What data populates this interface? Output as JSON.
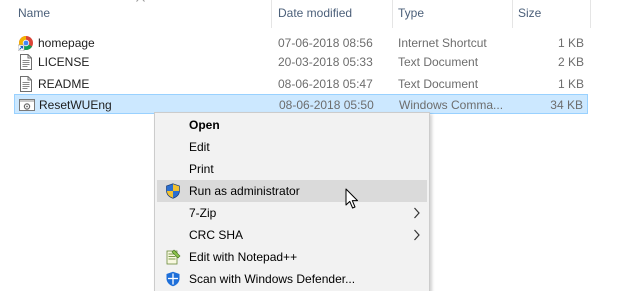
{
  "columns": {
    "name": "Name",
    "date": "Date modified",
    "type": "Type",
    "size": "Size"
  },
  "files": [
    {
      "name": "homepage",
      "date": "07-06-2018 08:56",
      "type": "Internet Shortcut",
      "size": "1 KB",
      "icon": "chrome-shortcut-icon",
      "selected": false
    },
    {
      "name": "LICENSE",
      "date": "20-03-2018 05:33",
      "type": "Text Document",
      "size": "2 KB",
      "icon": "text-document-icon",
      "selected": false
    },
    {
      "name": "README",
      "date": "08-06-2018 05:47",
      "type": "Text Document",
      "size": "1 KB",
      "icon": "text-document-icon",
      "selected": false
    },
    {
      "name": "ResetWUEng",
      "date": "08-06-2018 05:50",
      "type": "Windows Comma...",
      "size": "34 KB",
      "icon": "batch-file-icon",
      "selected": true
    }
  ],
  "context_menu": {
    "items": [
      {
        "label": "Open",
        "bold": true
      },
      {
        "label": "Edit"
      },
      {
        "label": "Print"
      },
      {
        "label": "Run as administrator",
        "icon": "uac-shield-icon",
        "highlighted": true
      },
      {
        "label": "7-Zip",
        "submenu": true
      },
      {
        "label": "CRC SHA",
        "submenu": true
      },
      {
        "label": "Edit with Notepad++",
        "icon": "notepad-plus-plus-icon"
      },
      {
        "label": "Scan with Windows Defender...",
        "icon": "windows-defender-icon"
      }
    ]
  },
  "colors": {
    "selection_bg": "#cce8ff",
    "selection_border": "#99d1ff",
    "menu_bg": "#f2f2f2",
    "menu_hover": "#dadada",
    "header_text": "#4c607a"
  }
}
